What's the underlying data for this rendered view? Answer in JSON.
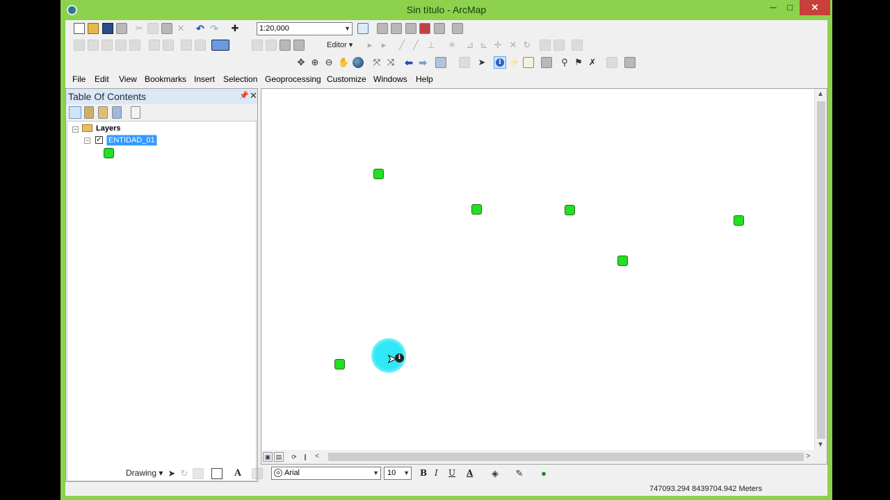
{
  "window": {
    "title": "Sin título - ArcMap",
    "minimize": "─",
    "maximize": "□",
    "close": "✕"
  },
  "toolbar": {
    "scale": "1:20,000",
    "editor_label": "Editor ▾"
  },
  "menu": [
    "File",
    "Edit",
    "View",
    "Bookmarks",
    "Insert",
    "Selection",
    "Geoprocessing",
    "Customize",
    "Windows",
    "Help"
  ],
  "toc": {
    "title": "Table Of Contents",
    "pin": "ᵖ",
    "close": "✕",
    "layers_label": "Layers",
    "layer_name": "ENTIDAD_01",
    "symbol_color": "#22e022"
  },
  "map": {
    "point_color": "#22e022",
    "point_count": 7
  },
  "drawing": {
    "label": "Drawing ▾",
    "font": "Arial",
    "font_size": "10",
    "bold": "B",
    "italic": "I",
    "underline": "U",
    "font_color_glyph": "A"
  },
  "status": {
    "coordinates": "747093.294  8439704.942 Meters"
  }
}
